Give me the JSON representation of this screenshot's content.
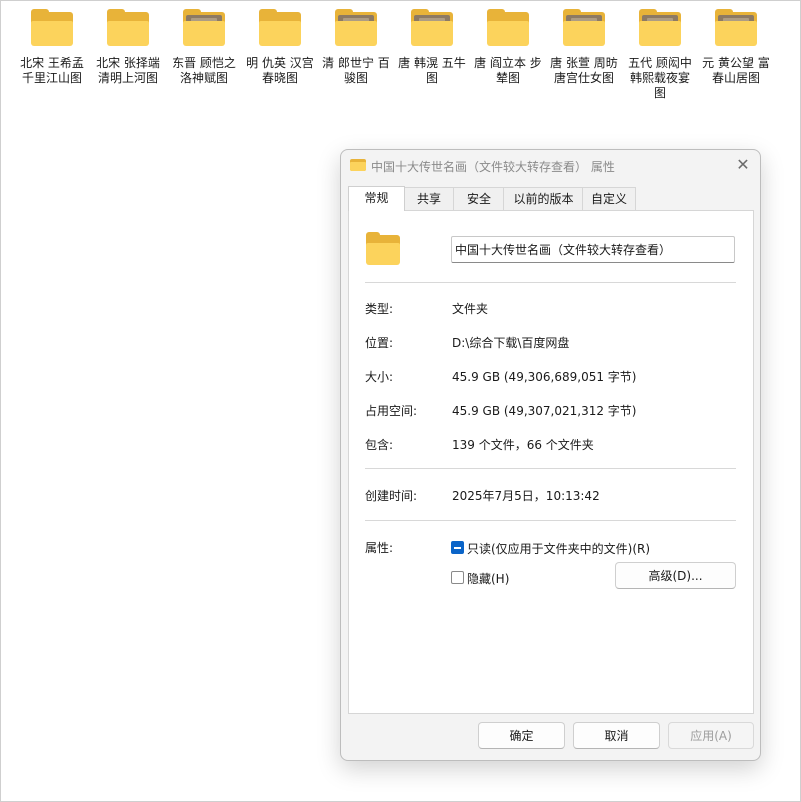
{
  "desktop": {
    "folders": [
      {
        "name": "北宋 王希孟 千里江山图",
        "thumbnail": false
      },
      {
        "name": "北宋 张择端 清明上河图",
        "thumbnail": false
      },
      {
        "name": "东晋 顾恺之 洛神赋图",
        "thumbnail": true
      },
      {
        "name": "明 仇英 汉宫春晓图",
        "thumbnail": false
      },
      {
        "name": "清 郎世宁 百骏图",
        "thumbnail": true
      },
      {
        "name": "唐 韩滉 五牛图",
        "thumbnail": true
      },
      {
        "name": "唐 阎立本 步辇图",
        "thumbnail": false
      },
      {
        "name": "唐 张萱 周昉 唐宫仕女图",
        "thumbnail": true
      },
      {
        "name": "五代 顾闳中 韩熙载夜宴图",
        "thumbnail": true
      },
      {
        "name": "元 黄公望 富春山居图",
        "thumbnail": true
      }
    ]
  },
  "dialog": {
    "title": "中国十大传世名画（文件较大转存查看） 属性",
    "close_glyph": "✕",
    "tabs": [
      {
        "label": "常规",
        "active": true
      },
      {
        "label": "共享",
        "active": false
      },
      {
        "label": "安全",
        "active": false
      },
      {
        "label": "以前的版本",
        "active": false
      },
      {
        "label": "自定义",
        "active": false
      }
    ],
    "folder_name": "中国十大传世名画（文件较大转存查看）",
    "props": {
      "type_label": "类型:",
      "type_value": "文件夹",
      "location_label": "位置:",
      "location_value": "D:\\综合下载\\百度网盘",
      "size_label": "大小:",
      "size_value": "45.9 GB (49,306,689,051 字节)",
      "disk_label": "占用空间:",
      "disk_value": "45.9 GB (49,307,021,312 字节)",
      "contains_label": "包含:",
      "contains_value": "139 个文件，66 个文件夹",
      "created_label": "创建时间:",
      "created_value": "2025年7月5日，10:13:42",
      "attributes_label": "属性:"
    },
    "attributes": {
      "readonly_label": "只读(仅应用于文件夹中的文件)(R)",
      "readonly_state": "indeterminate",
      "hidden_label": "隐藏(H)",
      "hidden_state": "unchecked",
      "advanced_label": "高级(D)..."
    },
    "buttons": {
      "ok": "确定",
      "cancel": "取消",
      "apply": "应用(A)",
      "apply_enabled": false
    },
    "colors": {
      "folder_front": "#fcd35c",
      "folder_back": "#e8b339",
      "accent": "#0a64c8"
    }
  }
}
